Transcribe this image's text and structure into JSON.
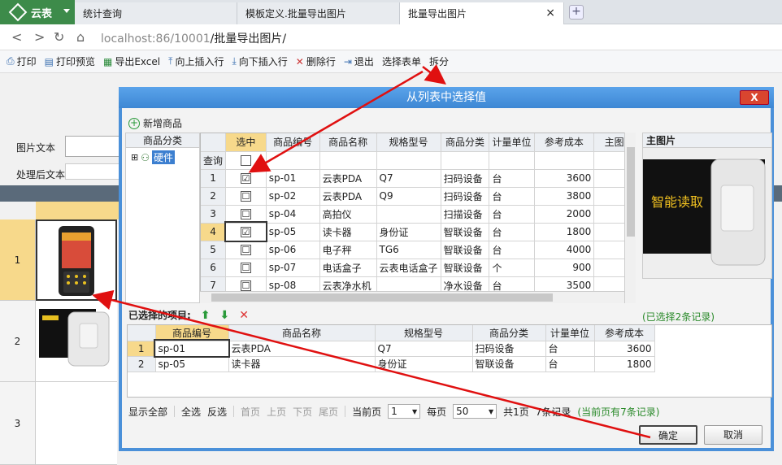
{
  "browser": {
    "app_name": "云表",
    "tabs": [
      {
        "label": "统计查询"
      },
      {
        "label": "模板定义.批量导出图片"
      },
      {
        "label": "批量导出图片"
      }
    ],
    "url_host": "localhost:86/10001",
    "url_path": "/批量导出图片/"
  },
  "toolbar": {
    "items": [
      {
        "label": "打印",
        "icon": "printer-icon"
      },
      {
        "label": "打印预览",
        "icon": "print-preview-icon"
      },
      {
        "label": "导出Excel",
        "icon": "excel-icon"
      },
      {
        "label": "向上插入行",
        "icon": "insert-above-icon"
      },
      {
        "label": "向下插入行",
        "icon": "insert-below-icon"
      },
      {
        "label": "删除行",
        "icon": "delete-row-icon"
      },
      {
        "label": "退出",
        "icon": "exit-icon"
      },
      {
        "label": "选择表单",
        "icon": ""
      },
      {
        "label": "拆分",
        "icon": ""
      }
    ]
  },
  "form": {
    "image_text_label": "图片文本",
    "processed_text_label": "处理后文本",
    "row_numbers": [
      "1",
      "2",
      "3"
    ]
  },
  "dialog": {
    "title": "从列表中选择值",
    "close_label": "X",
    "add_goods_label": "新增商品",
    "tree_header": "商品分类",
    "tree_node_expand": "⊞",
    "tree_node": "硬件",
    "columns": [
      "选中",
      "商品编号",
      "商品名称",
      "规格型号",
      "商品分类",
      "计量单位",
      "参考成本",
      "主图"
    ],
    "query_label": "查询",
    "rows": [
      {
        "n": "1",
        "checked": "☑",
        "code": "sp-01",
        "name": "云表PDA",
        "spec": "Q7",
        "category": "扫码设备",
        "unit": "台",
        "cost": "3600"
      },
      {
        "n": "2",
        "checked": "☐",
        "code": "sp-02",
        "name": "云表PDA",
        "spec": "Q9",
        "category": "扫码设备",
        "unit": "台",
        "cost": "3800"
      },
      {
        "n": "3",
        "checked": "☐",
        "code": "sp-04",
        "name": "高拍仪",
        "spec": "",
        "category": "扫描设备",
        "unit": "台",
        "cost": "2000"
      },
      {
        "n": "4",
        "checked": "☑",
        "code": "sp-05",
        "name": "读卡器",
        "spec": "身份证",
        "category": "智联设备",
        "unit": "台",
        "cost": "1800"
      },
      {
        "n": "5",
        "checked": "☐",
        "code": "sp-06",
        "name": "电子秤",
        "spec": "TG6",
        "category": "智联设备",
        "unit": "台",
        "cost": "4000"
      },
      {
        "n": "6",
        "checked": "☐",
        "code": "sp-07",
        "name": "电话盒子",
        "spec": "云表电话盒子",
        "category": "智联设备",
        "unit": "个",
        "cost": "900"
      },
      {
        "n": "7",
        "checked": "☐",
        "code": "sp-08",
        "name": "云表净水机",
        "spec": "",
        "category": "净水设备",
        "unit": "台",
        "cost": "3500"
      }
    ],
    "image_panel_header": "主图片",
    "image_caption": "智能读取",
    "selected_label": "已选择的项目:",
    "selected_count": "(已选择2条记录)",
    "selected_columns": [
      "商品编号",
      "商品名称",
      "规格型号",
      "商品分类",
      "计量单位",
      "参考成本"
    ],
    "selected_rows": [
      {
        "n": "1",
        "code": "sp-01",
        "name": "云表PDA",
        "spec": "Q7",
        "category": "扫码设备",
        "unit": "台",
        "cost": "3600"
      },
      {
        "n": "2",
        "code": "sp-05",
        "name": "读卡器",
        "spec": "身份证",
        "category": "智联设备",
        "unit": "台",
        "cost": "1800"
      }
    ],
    "pager": {
      "show_all": "显示全部",
      "select_all": "全选",
      "invert": "反选",
      "first": "首页",
      "prev": "上页",
      "next": "下页",
      "last": "尾页",
      "current_page_label": "当前页",
      "current_page": "1",
      "per_page_label": "每页",
      "per_page": "50",
      "total_pages": "共1页",
      "total_records": "7条记录",
      "page_records": "(当前页有7条记录)"
    },
    "ok_label": "确定",
    "cancel_label": "取消"
  },
  "colors": {
    "arrow": "#e01010",
    "accent": "#4a90d9",
    "selected_row": "#f7d98b"
  }
}
